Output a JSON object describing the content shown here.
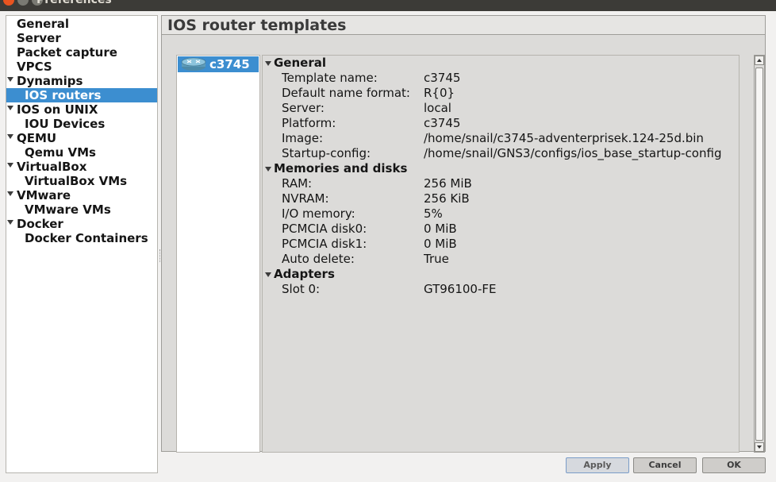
{
  "window": {
    "title": "Preferences"
  },
  "sidebar": {
    "items": [
      {
        "label": "General",
        "level": 0,
        "expanded": false
      },
      {
        "label": "Server",
        "level": 0,
        "expanded": false
      },
      {
        "label": "Packet capture",
        "level": 0,
        "expanded": false
      },
      {
        "label": "VPCS",
        "level": 0,
        "expanded": false
      },
      {
        "label": "Dynamips",
        "level": 0,
        "expanded": true
      },
      {
        "label": "IOS routers",
        "level": 1,
        "selected": true
      },
      {
        "label": "IOS on UNIX",
        "level": 0,
        "expanded": true
      },
      {
        "label": "IOU Devices",
        "level": 1
      },
      {
        "label": "QEMU",
        "level": 0,
        "expanded": true
      },
      {
        "label": "Qemu VMs",
        "level": 1
      },
      {
        "label": "VirtualBox",
        "level": 0,
        "expanded": true
      },
      {
        "label": "VirtualBox VMs",
        "level": 1
      },
      {
        "label": "VMware",
        "level": 0,
        "expanded": true
      },
      {
        "label": "VMware VMs",
        "level": 1
      },
      {
        "label": "Docker",
        "level": 0,
        "expanded": true
      },
      {
        "label": "Docker Containers",
        "level": 1
      }
    ]
  },
  "panel": {
    "title": "IOS router templates"
  },
  "templates": {
    "items": [
      {
        "label": "c3745",
        "icon": "router-icon",
        "selected": true
      }
    ]
  },
  "details": {
    "sections": [
      {
        "title": "General",
        "rows": [
          {
            "key": "Template name:",
            "value": "c3745"
          },
          {
            "key": "Default name format:",
            "value": "R{0}"
          },
          {
            "key": "Server:",
            "value": "local"
          },
          {
            "key": "Platform:",
            "value": "c3745"
          },
          {
            "key": "Image:",
            "value": "/home/snail/c3745-adventerprisek.124-25d.bin"
          },
          {
            "key": "Startup-config:",
            "value": "/home/snail/GNS3/configs/ios_base_startup-config"
          }
        ]
      },
      {
        "title": "Memories and disks",
        "rows": [
          {
            "key": "RAM:",
            "value": "256 MiB"
          },
          {
            "key": "NVRAM:",
            "value": "256 KiB"
          },
          {
            "key": "I/O memory:",
            "value": "5%"
          },
          {
            "key": "PCMCIA disk0:",
            "value": "0 MiB"
          },
          {
            "key": "PCMCIA disk1:",
            "value": "0 MiB"
          },
          {
            "key": "Auto delete:",
            "value": "True"
          }
        ]
      },
      {
        "title": "Adapters",
        "rows": [
          {
            "key": "Slot 0:",
            "value": "GT96100-FE"
          }
        ]
      }
    ]
  },
  "buttons": {
    "apply": "Apply",
    "cancel": "Cancel",
    "ok": "OK"
  },
  "colors": {
    "selection": "#3c8ed0",
    "panel_bg": "#dcdbd9",
    "dialog_bg": "#f2f1f0"
  }
}
